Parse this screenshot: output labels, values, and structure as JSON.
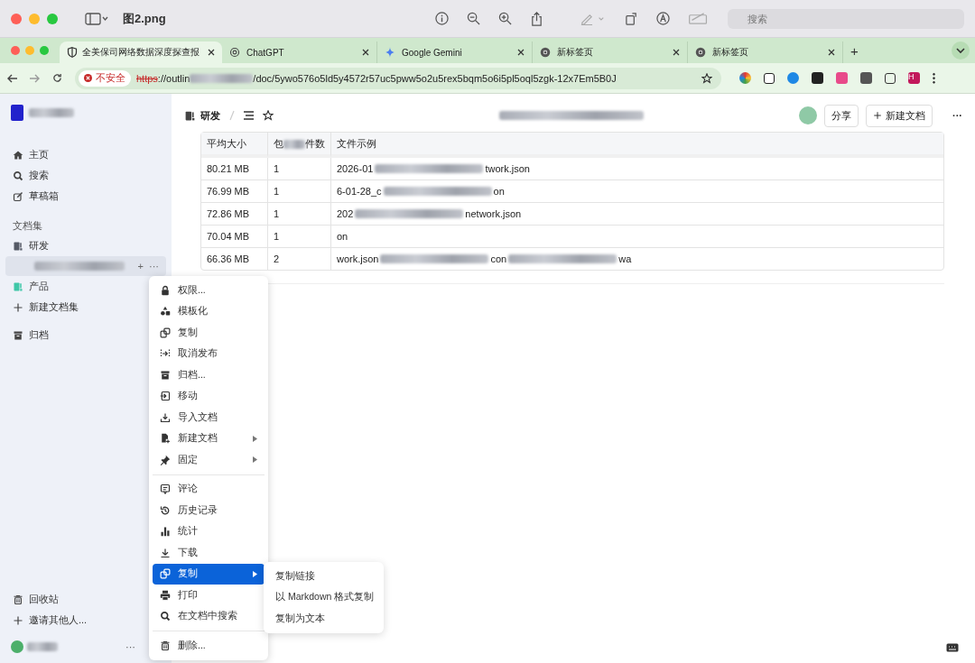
{
  "viewer": {
    "title": "图2.png",
    "search_placeholder": "搜索"
  },
  "browser": {
    "tabs": [
      {
        "title": "全美保司网络数据深度探查报",
        "selected": true
      },
      {
        "title": "ChatGPT",
        "selected": false
      },
      {
        "title": "Google Gemini",
        "selected": false
      },
      {
        "title": "新标签页",
        "selected": false
      },
      {
        "title": "新标签页",
        "selected": false
      }
    ],
    "new_tab": "+",
    "address": {
      "security": "不安全",
      "scheme": "https",
      "host": "://outlin",
      "path": "/doc/5ywo576o5ld5y4572r57uc5pww5o2u5rex5bqm5o6i5pl5oql5zgk-12x7Em5B0J"
    },
    "profile": "H"
  },
  "sidebar": {
    "nav": [
      {
        "label": "主页"
      },
      {
        "label": "搜索"
      },
      {
        "label": "草稿箱"
      }
    ],
    "section_title": "文档集",
    "collections": [
      {
        "label": "研发",
        "color": "#555a66"
      },
      {
        "label": "产品",
        "color": "#3fc7a8"
      }
    ],
    "doc_actions": {
      "add": "+",
      "more": "···"
    },
    "after": [
      {
        "label": "新建文档集"
      },
      {
        "label": "归档"
      }
    ],
    "footer": [
      {
        "label": "回收站"
      },
      {
        "label": "邀请其他人..."
      }
    ],
    "user_more": "···"
  },
  "header": {
    "breadcrumb": "研发",
    "share": "分享",
    "new_doc": "新建文档",
    "more": "···"
  },
  "table": {
    "columns": [
      [
        "平均大小"
      ],
      [
        "包",
        "件数"
      ],
      [
        "文件示例"
      ]
    ],
    "rows": [
      {
        "size": "80.21 MB",
        "count": "1",
        "example": [
          "2026-01",
          "twork.json"
        ]
      },
      {
        "size": "76.99 MB",
        "count": "1",
        "example": [
          "6-01-28_c",
          "on"
        ]
      },
      {
        "size": "72.86 MB",
        "count": "1",
        "example": [
          "202",
          "network.json"
        ]
      },
      {
        "size": "70.04 MB",
        "count": "1",
        "example": [
          "on"
        ]
      },
      {
        "size": "66.36 MB",
        "count": "2",
        "example": [
          "work.json",
          "con",
          "wa"
        ]
      }
    ]
  },
  "menu": {
    "items": [
      {
        "kind": "item",
        "label": "权限...",
        "submenu": false,
        "selected": false
      },
      {
        "kind": "item",
        "label": "模板化",
        "submenu": false,
        "selected": false
      },
      {
        "kind": "item",
        "label": "复制",
        "submenu": false,
        "selected": false
      },
      {
        "kind": "item",
        "label": "取消发布",
        "submenu": false,
        "selected": false
      },
      {
        "kind": "item",
        "label": "归档...",
        "submenu": false,
        "selected": false
      },
      {
        "kind": "item",
        "label": "移动",
        "submenu": false,
        "selected": false
      },
      {
        "kind": "item",
        "label": "导入文档",
        "submenu": false,
        "selected": false
      },
      {
        "kind": "item",
        "label": "新建文档",
        "submenu": true,
        "selected": false
      },
      {
        "kind": "item",
        "label": "固定",
        "submenu": true,
        "selected": false
      },
      {
        "kind": "divider"
      },
      {
        "kind": "item",
        "label": "评论",
        "submenu": false,
        "selected": false
      },
      {
        "kind": "item",
        "label": "历史记录",
        "submenu": false,
        "selected": false
      },
      {
        "kind": "item",
        "label": "统计",
        "submenu": false,
        "selected": false
      },
      {
        "kind": "item",
        "label": "下载",
        "submenu": false,
        "selected": false
      },
      {
        "kind": "item",
        "label": "复制",
        "submenu": true,
        "selected": true
      },
      {
        "kind": "item",
        "label": "打印",
        "submenu": false,
        "selected": false
      },
      {
        "kind": "item",
        "label": "在文档中搜索",
        "submenu": false,
        "selected": false
      },
      {
        "kind": "divider"
      },
      {
        "kind": "item",
        "label": "删除...",
        "submenu": false,
        "selected": false
      }
    ],
    "submenu": [
      "复制链接",
      "以 Markdown 格式复制",
      "复制为文本"
    ]
  }
}
